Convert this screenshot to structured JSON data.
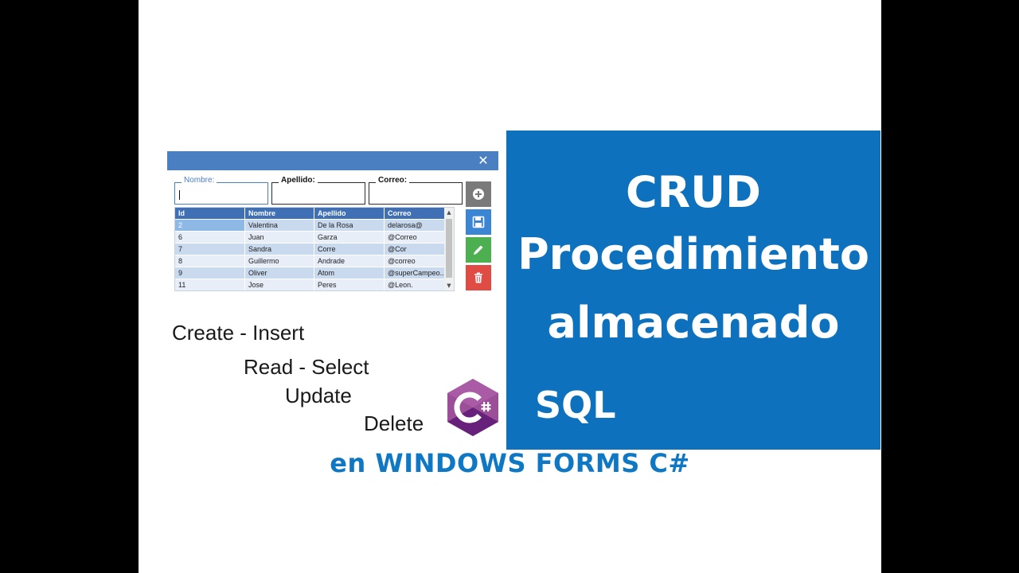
{
  "window": {
    "close_glyph": "✕",
    "fields": [
      {
        "label": "Nombre:",
        "value": ""
      },
      {
        "label": "Apellido:",
        "value": ""
      },
      {
        "label": "Correo:",
        "value": ""
      }
    ],
    "grid": {
      "columns": [
        "Id",
        "Nombre",
        "Apellido",
        "Correo"
      ],
      "rows": [
        [
          "2",
          "Valentina",
          "De la Rosa",
          "delarosa@"
        ],
        [
          "6",
          "Juan",
          "Garza",
          "@Correo"
        ],
        [
          "7",
          "Sandra",
          "Corre",
          "@Cor"
        ],
        [
          "8",
          "Guillermo",
          "Andrade",
          "@correo"
        ],
        [
          "9",
          "Oliver",
          "Atom",
          "@superCampeo..."
        ],
        [
          "11",
          "Jose",
          "Peres",
          "@Leon."
        ]
      ]
    },
    "buttons": [
      {
        "icon": "add-icon",
        "color": "#7a7a7a"
      },
      {
        "icon": "save-icon",
        "color": "#3a86d4"
      },
      {
        "icon": "edit-icon",
        "color": "#4cb050"
      },
      {
        "icon": "delete-icon",
        "color": "#e04b44"
      }
    ]
  },
  "crud_list": {
    "create": "Create - Insert",
    "read": "Read - Select",
    "update": "Update",
    "delete": "Delete"
  },
  "panel": {
    "line1": "CRUD",
    "line2": "Procedimiento",
    "line3": "almacenado",
    "sql": "SQL",
    "background": "#0d71bd"
  },
  "footer": {
    "title": "en WINDOWS FORMS C#",
    "color": "#0e78c4"
  },
  "logo": {
    "icon": "csharp-logo-icon",
    "text": "C#",
    "color": "#9b4f96"
  }
}
